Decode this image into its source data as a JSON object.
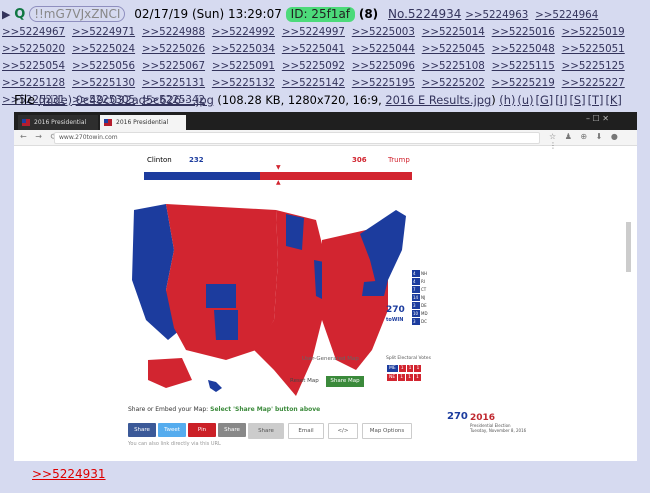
{
  "post": {
    "arrow": "▶",
    "name": "Q",
    "tripcode": "!!mG7VJxZNCI",
    "date": "02/17/19 (Sun) 13:29:07",
    "id_label": "ID: 25f1af",
    "count": "(8)",
    "number": "No.5224934",
    "replies": [
      ">>5224963",
      ">>5224964",
      ">>5224967",
      ">>5224971",
      ">>5224988",
      ">>5224992",
      ">>5224997",
      ">>5225003",
      ">>5225014",
      ">>5225016",
      ">>5225019",
      ">>5225020",
      ">>5225024",
      ">>5225026",
      ">>5225034",
      ">>5225041",
      ">>5225044",
      ">>5225045",
      ">>5225048",
      ">>5225051",
      ">>5225054",
      ">>5225056",
      ">>5225067",
      ">>5225091",
      ">>5225092",
      ">>5225096",
      ">>5225108",
      ">>5225115",
      ">>5225125",
      ">>5225128",
      ">>5225130",
      ">>5225131",
      ">>5225132",
      ">>5225142",
      ">>5225195",
      ">>5225202",
      ">>5225219",
      ">>5225227",
      ">>5225231",
      ">>5225305",
      ">>5225342"
    ],
    "backlink": ">>5224931"
  },
  "file": {
    "label": "File",
    "hide": "(hide)",
    "name": "0c49c032ad5c626⋯.jpg",
    "meta": "(108.28 KB, 1280x720, 16:9,",
    "orig": "2016 E Results.jpg",
    "close": ")",
    "tools": [
      "(h)",
      "(u)",
      "[G]",
      "[I]",
      "[S]",
      "[T]",
      "[K]"
    ]
  },
  "screenshot": {
    "tabs": [
      "2016 Presidential Electio",
      "2016 Presidential Electio"
    ],
    "window_controls": "–   ☐   ✕",
    "nav_icons": "← → ⟳",
    "url": "www.270towin.com",
    "toolbar_icons": "☆ ♟ ⊕ ⬇ ● ⋮",
    "clinton_label": "Clinton",
    "clinton_ev": "232",
    "trump_ev": "306",
    "trump_label": "Trump",
    "clinton_share": 0.431,
    "small_states": [
      [
        "NH",
        "4"
      ],
      [
        "RI",
        "4"
      ],
      [
        "CT",
        "7"
      ],
      [
        "NJ",
        "14"
      ],
      [
        "DE",
        "3"
      ],
      [
        "MD",
        "10"
      ],
      [
        "DC",
        "3"
      ]
    ],
    "logo_270": "270",
    "logo_towin": "toWIN",
    "user_map_label": "User-Generated Map",
    "reset_label": "Reset Map",
    "share_label": "Share Map",
    "split_title": "Split Electoral Votes",
    "split_rows": [
      [
        "ME",
        "1",
        "1",
        "1"
      ],
      [
        "NE",
        "1",
        "1",
        "1"
      ]
    ],
    "embed_text": "Share or Embed your Map:",
    "embed_select": "Select 'Share Map' button above",
    "buttons": [
      "Share",
      "Tweet",
      "Pin",
      "Share",
      "Share",
      "Email",
      "</>",
      "Map Options"
    ],
    "tip": "You can also link directly via this URL",
    "ad_year": "2016",
    "ad_sub": "Presidential Election",
    "ad_date": "Tuesday, November 8, 2016",
    "colors": {
      "democrat": "#1c3c9e",
      "republican": "#d22530"
    }
  }
}
